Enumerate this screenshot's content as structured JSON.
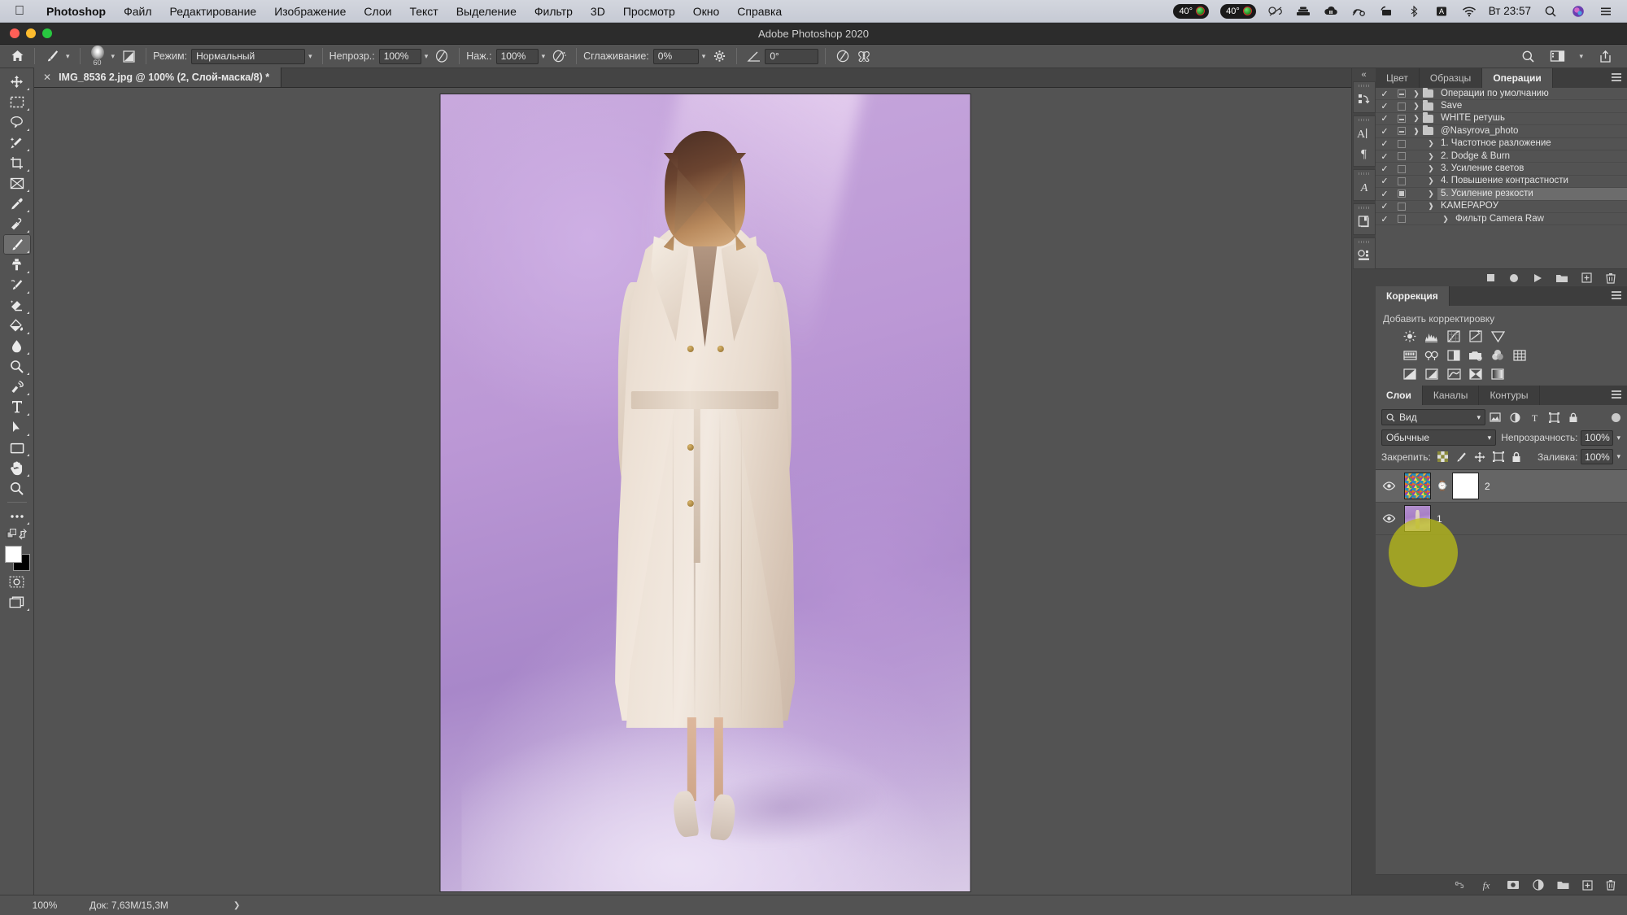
{
  "macbar": {
    "apple_icon": "apple-icon",
    "app_name": "Photoshop",
    "menus": [
      "Файл",
      "Редактирование",
      "Изображение",
      "Слои",
      "Текст",
      "Выделение",
      "Фильтр",
      "3D",
      "Просмотр",
      "Окно",
      "Справка"
    ],
    "status_badges": [
      {
        "label": "40°",
        "has_dot": true
      },
      {
        "label": "40°",
        "has_dot": true
      }
    ],
    "status_icons": [
      "creative-cloud-icon",
      "server-stack-icon",
      "cloud-pause-icon",
      "cloud-sync-icon",
      "screen-share-icon",
      "bluetooth-icon",
      "input-source-icon",
      "wifi-icon"
    ],
    "clock": "Вт 23:57",
    "search_icon": "search-icon",
    "siri_icon": "siri-icon",
    "control_center_icon": "control-center-icon"
  },
  "window": {
    "title": "Adobe Photoshop 2020",
    "traffic_lights": [
      "close",
      "minimize",
      "zoom"
    ]
  },
  "options_bar": {
    "home_icon": "home-icon",
    "tool_icon": "brush-tool-icon",
    "brush_size": "60",
    "brush_preset_icon": "brush-preset-icon",
    "brush_panel_icon": "brush-settings-panel-icon",
    "mode_label": "Режим:",
    "mode_value": "Нормальный",
    "opacity_label": "Непрозр.:",
    "opacity_value": "100%",
    "opacity_pressure_icon": "pressure-opacity-icon",
    "flow_label": "Наж.:",
    "flow_value": "100%",
    "airbrush_icon": "airbrush-icon",
    "smoothing_label": "Сглаживание:",
    "smoothing_value": "0%",
    "smoothing_gear_icon": "gear-icon",
    "angle_icon": "angle-icon",
    "angle_value": "0°",
    "pressure_size_icon": "pressure-size-icon",
    "symmetry_icon": "symmetry-butterfly-icon",
    "right_icons": [
      "search-icon",
      "workspace-icon",
      "chevron-down-icon",
      "share-icon"
    ]
  },
  "document": {
    "tab_title": "IMG_8536 2.jpg @ 100% (2, Слой-маска/8) *",
    "close_icon": "close-icon"
  },
  "toolbar": {
    "tools": [
      {
        "name": "move-tool",
        "icon": "move-icon",
        "selected": false
      },
      {
        "name": "marquee-tool",
        "icon": "rectangular-marquee-icon",
        "selected": false
      },
      {
        "name": "lasso-tool",
        "icon": "lasso-icon",
        "selected": false
      },
      {
        "name": "quick-selection-tool",
        "icon": "magic-wand-icon",
        "selected": false
      },
      {
        "name": "crop-tool",
        "icon": "crop-icon",
        "selected": false
      },
      {
        "name": "frame-tool",
        "icon": "frame-icon",
        "selected": false
      },
      {
        "name": "eyedropper-tool",
        "icon": "eyedropper-icon",
        "selected": false
      },
      {
        "name": "healing-brush-tool",
        "icon": "healing-brush-icon",
        "selected": false
      },
      {
        "name": "brush-tool",
        "icon": "brush-icon",
        "selected": true
      },
      {
        "name": "clone-stamp-tool",
        "icon": "clone-stamp-icon",
        "selected": false
      },
      {
        "name": "history-brush-tool",
        "icon": "history-brush-icon",
        "selected": false
      },
      {
        "name": "eraser-tool",
        "icon": "eraser-icon",
        "selected": false
      },
      {
        "name": "gradient-tool",
        "icon": "paint-bucket-icon",
        "selected": false
      },
      {
        "name": "blur-tool",
        "icon": "blur-droplet-icon",
        "selected": false
      },
      {
        "name": "dodge-tool",
        "icon": "dodge-icon",
        "selected": false
      },
      {
        "name": "pen-tool",
        "icon": "pen-icon",
        "selected": false
      },
      {
        "name": "type-tool",
        "icon": "type-icon",
        "selected": false
      },
      {
        "name": "path-selection-tool",
        "icon": "path-arrow-icon",
        "selected": false
      },
      {
        "name": "shape-tool",
        "icon": "rectangle-icon",
        "selected": false
      },
      {
        "name": "hand-tool",
        "icon": "hand-icon",
        "selected": false
      },
      {
        "name": "zoom-tool",
        "icon": "magnifier-icon",
        "selected": false
      },
      {
        "name": "edit-toolbar",
        "icon": "ellipsis-icon",
        "selected": false
      }
    ],
    "swap_colors_icon": "swap-colors-icon",
    "default_colors_icon": "default-colors-icon",
    "foreground_color": "#ffffff",
    "background_color": "#000000",
    "quick_mask_icon": "quick-mask-icon",
    "screen_mode_icon": "screen-mode-icon"
  },
  "rail": {
    "collapse_icon": "collapse-panels-icon",
    "groups": [
      [
        "history-icon"
      ],
      [
        "character-panel-icon",
        "paragraph-panel-icon"
      ],
      [
        "glyphs-panel-icon"
      ],
      [
        "libraries-panel-icon"
      ],
      [
        "properties-3d-panel-icon"
      ]
    ]
  },
  "actions_panel": {
    "tabs": [
      {
        "label": "Цвет",
        "active": false
      },
      {
        "label": "Образцы",
        "active": false
      },
      {
        "label": "Операции",
        "active": true
      }
    ],
    "menu_icon": "panel-menu-icon",
    "rows": [
      {
        "checked": true,
        "box": "dash",
        "expandable": true,
        "folder": true,
        "label": "Операции по умолчанию",
        "indent": 0,
        "selected": false
      },
      {
        "checked": true,
        "box": "empty",
        "expandable": true,
        "folder": true,
        "label": "Save",
        "indent": 0,
        "selected": false
      },
      {
        "checked": true,
        "box": "dash",
        "expandable": true,
        "folder": true,
        "label": "WHITE  ретушь",
        "indent": 0,
        "selected": false
      },
      {
        "checked": true,
        "box": "dash",
        "expandable": true,
        "expanded": true,
        "folder": true,
        "label": "@Nasyrova_photo",
        "indent": 0,
        "selected": false
      },
      {
        "checked": true,
        "box": "empty",
        "expandable": true,
        "folder": false,
        "label": "1. Частотное разложение",
        "indent": 1,
        "selected": false
      },
      {
        "checked": true,
        "box": "empty",
        "expandable": true,
        "folder": false,
        "label": "2. Dodge & Burn",
        "indent": 1,
        "selected": false
      },
      {
        "checked": true,
        "box": "empty",
        "expandable": true,
        "folder": false,
        "label": "3. Усиление светов",
        "indent": 1,
        "selected": false
      },
      {
        "checked": true,
        "box": "empty",
        "expandable": true,
        "folder": false,
        "label": "4. Повышение контрастности",
        "indent": 1,
        "selected": false
      },
      {
        "checked": true,
        "box": "fill",
        "expandable": true,
        "folder": false,
        "label": "5. Усиление резкости",
        "indent": 1,
        "selected": true
      },
      {
        "checked": true,
        "box": "empty",
        "expandable": true,
        "expanded": true,
        "folder": false,
        "label": "KAMEPAPOУ",
        "indent": 1,
        "selected": false
      },
      {
        "checked": true,
        "box": "empty",
        "expandable": true,
        "folder": false,
        "label": "Фильтр Camera Raw",
        "indent": 2,
        "selected": false
      }
    ],
    "footer_icons": [
      "stop-icon",
      "record-icon",
      "play-icon",
      "new-set-icon",
      "new-action-icon",
      "delete-icon"
    ]
  },
  "adjustments_panel": {
    "tab_label": "Коррекция",
    "menu_icon": "panel-menu-icon",
    "title": "Добавить корректировку",
    "rows": [
      [
        "brightness-contrast-icon",
        "levels-icon",
        "curves-icon",
        "exposure-icon",
        "vibrance-icon"
      ],
      [
        "hue-saturation-icon",
        "color-balance-icon",
        "black-white-icon",
        "photo-filter-icon",
        "channel-mixer-icon",
        "color-lookup-icon"
      ],
      [
        "invert-icon",
        "posterize-icon",
        "threshold-icon",
        "selective-color-icon",
        "gradient-map-icon"
      ]
    ]
  },
  "layers_panel": {
    "tabs": [
      {
        "label": "Слои",
        "active": true
      },
      {
        "label": "Каналы",
        "active": false
      },
      {
        "label": "Контуры",
        "active": false
      }
    ],
    "menu_icon": "panel-menu-icon",
    "filter_icon": "search-icon",
    "filter_value": "Вид",
    "filter_type_icons": [
      "pixel-filter-icon",
      "adjustment-filter-icon",
      "type-filter-icon",
      "shape-filter-icon",
      "smart-object-filter-icon"
    ],
    "filter_toggle_icon": "filter-toggle-icon",
    "blend_mode": "Обычные",
    "opacity_label": "Непрозрачность:",
    "opacity_value": "100%",
    "lock_label": "Закрепить:",
    "lock_icons": [
      "lock-transparent-pixels-icon",
      "lock-image-pixels-icon",
      "lock-position-icon",
      "lock-artboard-icon",
      "lock-all-icon"
    ],
    "fill_label": "Заливка:",
    "fill_value": "100%",
    "layers": [
      {
        "name": "2",
        "visible": true,
        "visibility_icon": "eye-icon",
        "thumb": "noise",
        "has_mask": true,
        "link_icon": "link-icon",
        "selected": true
      },
      {
        "name": "1",
        "visible": true,
        "visibility_icon": "eye-icon",
        "thumb": "photo",
        "has_mask": false,
        "selected": false
      }
    ],
    "footer_icons": [
      "link-layers-icon",
      "fx-icon",
      "add-mask-icon",
      "new-adjustment-icon",
      "new-group-icon",
      "new-layer-icon",
      "delete-layer-icon"
    ]
  },
  "status_bar": {
    "zoom": "100%",
    "doc_size": "Док: 7,63M/15,3M",
    "arrow_icon": "chevron-right-icon"
  },
  "colors": {
    "panel_bg": "#535353",
    "panel_dark": "#454545",
    "selection": "#6c6c6c",
    "cursor_highlight": "#bec014"
  }
}
